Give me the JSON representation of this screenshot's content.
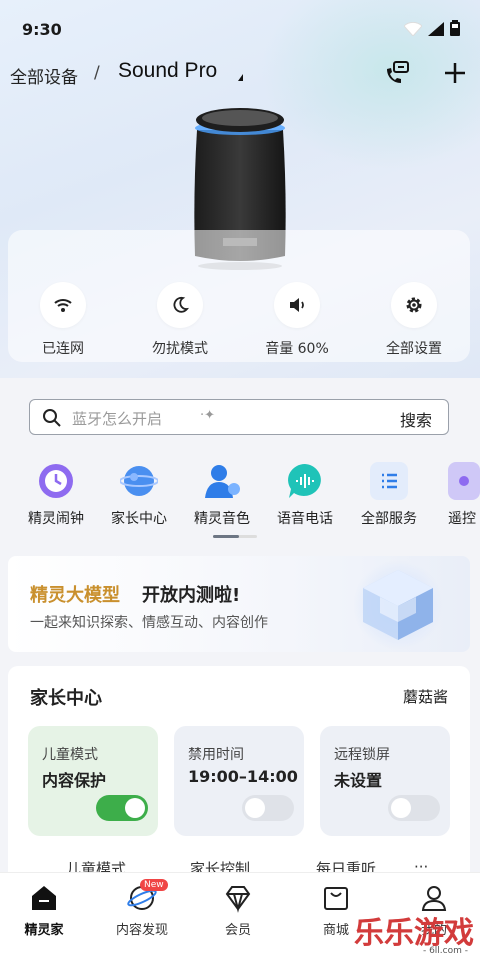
{
  "status_bar": {
    "time": "9:30"
  },
  "header": {
    "breadcrumb_all": "全部设备",
    "separator": "/",
    "device_name": "Sound Pro"
  },
  "device_controls": [
    {
      "label": "已连网",
      "icon": "wifi-icon"
    },
    {
      "label": "勿扰模式",
      "icon": "moon-icon"
    },
    {
      "label": "音量 60%",
      "icon": "volume-icon"
    },
    {
      "label": "全部设置",
      "icon": "gear-icon"
    }
  ],
  "search": {
    "placeholder": "蓝牙怎么开启",
    "button": "搜索"
  },
  "services": [
    {
      "label": "精灵闹钟",
      "icon": "alarm-clock-icon"
    },
    {
      "label": "家长中心",
      "icon": "planet-icon"
    },
    {
      "label": "精灵音色",
      "icon": "voice-avatar-icon"
    },
    {
      "label": "语音电话",
      "icon": "voice-call-icon"
    },
    {
      "label": "全部服务",
      "icon": "list-icon"
    },
    {
      "label": "遥控",
      "icon": "remote-icon"
    }
  ],
  "banner": {
    "title_highlight": "精灵大模型",
    "title_rest": "开放内测啦!",
    "subtitle": "一起来知识探索、情感互动、内容创作"
  },
  "parent_center": {
    "title": "家长中心",
    "profile": "蘑菇酱",
    "tiles": [
      {
        "label": "儿童模式",
        "value": "内容保护",
        "toggle_on": true
      },
      {
        "label": "禁用时间",
        "value": "19:00–14:00",
        "toggle_on": false
      },
      {
        "label": "远程锁屏",
        "value": "未设置",
        "toggle_on": false
      }
    ],
    "peek_items": [
      "儿童模式",
      "家长控制",
      "每日重听",
      "···"
    ]
  },
  "bottom_nav": {
    "items": [
      {
        "label": "精灵家",
        "icon": "home-icon",
        "active": true
      },
      {
        "label": "内容发现",
        "icon": "discover-planet-icon",
        "badge": "New"
      },
      {
        "label": "会员",
        "icon": "diamond-icon"
      },
      {
        "label": "商城",
        "icon": "shop-bag-icon"
      },
      {
        "label": "我的",
        "icon": "person-icon"
      }
    ]
  },
  "watermark": {
    "text": "乐乐游戏",
    "url": "- 6ll.com -"
  },
  "colors": {
    "accent_gold": "#c9902e",
    "toggle_green": "#3dae4a",
    "badge_red": "#f04545"
  }
}
